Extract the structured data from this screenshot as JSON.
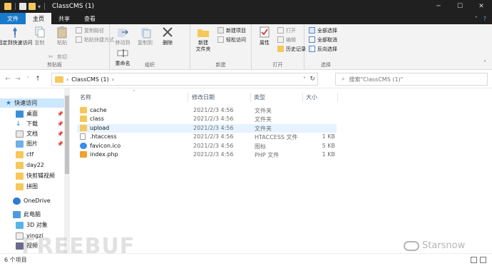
{
  "window": {
    "title": "ClassCMS (1)",
    "controls": [
      "─",
      "☐",
      "✕"
    ]
  },
  "ribbon_tabs": {
    "file": "文件",
    "home": "主页",
    "share": "共享",
    "view": "查看"
  },
  "ribbon": {
    "clipboard": {
      "label": "剪贴板",
      "pin_quick_access": "固定到快速访问",
      "copy": "复制",
      "paste": "粘贴",
      "cut": "剪切",
      "copy_path": "复制路径",
      "paste_shortcut": "粘贴快捷方式"
    },
    "organize": {
      "label": "组织",
      "move_to": "移动到",
      "copy_to": "复制到",
      "delete": "删除",
      "rename": "重命名"
    },
    "new": {
      "label": "新建",
      "new_folder": "新建\n文件夹",
      "new_item": "新建项目",
      "easy_access": "轻松访问"
    },
    "open": {
      "label": "打开",
      "properties": "属性",
      "open": "打开",
      "edit": "编辑",
      "history": "历史记录"
    },
    "select": {
      "label": "选择",
      "select_all": "全部选择",
      "select_none": "全部取消",
      "invert": "反向选择"
    }
  },
  "address": {
    "path": "ClassCMS (1)",
    "search_placeholder": "搜索\"ClassCMS (1)\""
  },
  "nav": {
    "quick_access": "快速访问",
    "items": [
      {
        "label": "桌面",
        "pinned": true
      },
      {
        "label": "下载",
        "pinned": true
      },
      {
        "label": "文档",
        "pinned": true
      },
      {
        "label": "图片",
        "pinned": true
      },
      {
        "label": "ctf",
        "pinned": false
      },
      {
        "label": "day22",
        "pinned": false
      },
      {
        "label": "快剪辑视频",
        "pinned": false
      },
      {
        "label": "拼图",
        "pinned": false
      }
    ],
    "onedrive": "OneDrive",
    "this_pc": "此电脑",
    "pc_items": [
      "3D 对象",
      "yingzi",
      "视频"
    ]
  },
  "columns": {
    "name": "名称",
    "date": "修改日期",
    "type": "类型",
    "size": "大小"
  },
  "files": [
    {
      "name": "cache",
      "date": "2021/2/3 4:56",
      "type": "文件夹",
      "size": "",
      "icon": "folder-icon",
      "color": "#f6c85a"
    },
    {
      "name": "class",
      "date": "2021/2/3 4:56",
      "type": "文件夹",
      "size": "",
      "icon": "folder-icon",
      "color": "#f6c85a"
    },
    {
      "name": "upload",
      "date": "2021/2/3 4:56",
      "type": "文件夹",
      "size": "",
      "icon": "folder-icon",
      "color": "#f6c85a",
      "selected": true
    },
    {
      "name": ".htaccess",
      "date": "2021/2/3 4:56",
      "type": "HTACCESS 文件",
      "size": "1 KB",
      "icon": "file-icon",
      "color": "#ffffff"
    },
    {
      "name": "favicon.ico",
      "date": "2021/2/3 4:56",
      "type": "图标",
      "size": "5 KB",
      "icon": "favicon-icon",
      "color": "#3a8ee6"
    },
    {
      "name": "index.php",
      "date": "2021/2/3 4:56",
      "type": "PHP 文件",
      "size": "1 KB",
      "icon": "php-file-icon",
      "color": "#f0a030"
    }
  ],
  "status": {
    "count": "6 个项目"
  },
  "watermarks": {
    "left": "FREEBUF",
    "right": "Starsnow"
  },
  "colors": {
    "accent": "#1979ca",
    "selection": "#cce8ff",
    "folder": "#f6c85a"
  }
}
